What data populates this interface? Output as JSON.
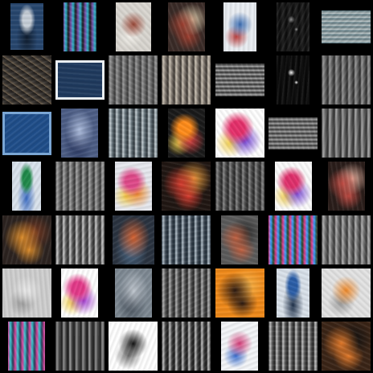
{
  "gallery": {
    "background": "#000000",
    "rows": 7,
    "cols": 7,
    "tiles": [
      {
        "w": 0.62,
        "h": 0.88,
        "bg": "#27466e",
        "a": "#c7cfd8",
        "b": "#0f1d2e",
        "kind": "portrait"
      },
      {
        "w": 0.62,
        "h": 0.92,
        "bg": "#1a1a1f",
        "a": "#7a4fa8",
        "b": "#2fb3c9",
        "kind": "noisy"
      },
      {
        "w": 0.66,
        "h": 0.92,
        "bg": "#d9d6d0",
        "a": "#9c4a3a",
        "b": "#f1efe9",
        "kind": "light"
      },
      {
        "w": 0.7,
        "h": 0.92,
        "bg": "#3a2b27",
        "a": "#9c3e2f",
        "b": "#d9c9a9",
        "kind": "blob"
      },
      {
        "w": 0.62,
        "h": 0.92,
        "bg": "#e9edf2",
        "a": "#3b6db3",
        "b": "#b83c3c",
        "kind": "light"
      },
      {
        "w": 0.62,
        "h": 0.92,
        "bg": "#0a0a0a",
        "a": "#8a8a8a",
        "b": "#222",
        "kind": "dark"
      },
      {
        "w": 0.92,
        "h": 0.62,
        "bg": "#7a8a8e",
        "a": "#b8c4c6",
        "b": "#3c5d68",
        "kind": "wide"
      },
      {
        "w": 0.92,
        "h": 0.92,
        "bg": "#3a3632",
        "a": "#6e5f4c",
        "b": "#1e1b19",
        "kind": "texture"
      },
      {
        "w": 0.92,
        "h": 0.74,
        "bg": "#1f3a5e",
        "a": "#e9eef2",
        "b": "#2d6aa0",
        "kind": "framed"
      },
      {
        "w": 0.92,
        "h": 0.92,
        "bg": "#6a6a6a",
        "a": "#9b9b9b",
        "b": "#3a3a3a",
        "kind": "gray"
      },
      {
        "w": 0.92,
        "h": 0.92,
        "bg": "#7a726a",
        "a": "#cfc6b8",
        "b": "#3a3530",
        "kind": "gray"
      },
      {
        "w": 0.92,
        "h": 0.62,
        "bg": "#3a3a3a",
        "a": "#a9a9a9",
        "b": "#1a1a1a",
        "kind": "wide"
      },
      {
        "w": 0.62,
        "h": 0.92,
        "bg": "#050505",
        "a": "#ffffff",
        "b": "#111",
        "kind": "dark"
      },
      {
        "w": 0.92,
        "h": 0.92,
        "bg": "#5f5f5f",
        "a": "#999",
        "b": "#2b2b2b",
        "kind": "gray"
      },
      {
        "w": 0.92,
        "h": 0.82,
        "bg": "#1f4e8a",
        "a": "#7aa6d4",
        "b": "#0e2a4f",
        "kind": "framed"
      },
      {
        "w": 0.7,
        "h": 0.92,
        "bg": "#4d5e86",
        "a": "#b0c0e0",
        "b": "#23305a",
        "kind": "blur"
      },
      {
        "w": 0.92,
        "h": 0.92,
        "bg": "#5e6b72",
        "a": "#c7d1d6",
        "b": "#2f383e",
        "kind": "gray"
      },
      {
        "w": 0.7,
        "h": 0.92,
        "bg": "#1a1a1a",
        "a": "#ff8c1a",
        "b": "#d84040",
        "kind": "colorblob"
      },
      {
        "w": 0.92,
        "h": 0.92,
        "bg": "#ffffff",
        "a": "#e6306b",
        "b": "#6c3bd1",
        "kind": "colorblob"
      },
      {
        "w": 0.92,
        "h": 0.6,
        "bg": "#3c3c3c",
        "a": "#a5a5a5",
        "b": "#2a2a2a",
        "kind": "wide"
      },
      {
        "w": 0.92,
        "h": 0.92,
        "bg": "#5e5e5e",
        "a": "#a9a9a9",
        "b": "#2e2e2e",
        "kind": "gray"
      },
      {
        "w": 0.54,
        "h": 0.92,
        "bg": "#d9e2ec",
        "a": "#1f8a4a",
        "b": "#3b6cc3",
        "kind": "portrait"
      },
      {
        "w": 0.92,
        "h": 0.92,
        "bg": "#6b6b6b",
        "a": "#a8a8a8",
        "b": "#333",
        "kind": "gray"
      },
      {
        "w": 0.7,
        "h": 0.92,
        "bg": "#e6e8ee",
        "a": "#e04a8a",
        "b": "#f08a2a",
        "kind": "colorblob"
      },
      {
        "w": 0.92,
        "h": 0.92,
        "bg": "#201612",
        "a": "#d53b2e",
        "b": "#f0a03c",
        "kind": "blob"
      },
      {
        "w": 0.92,
        "h": 0.92,
        "bg": "#4a4a4a",
        "a": "#8b8b8b",
        "b": "#262626",
        "kind": "gray"
      },
      {
        "w": 0.7,
        "h": 0.92,
        "bg": "#fbfbfb",
        "a": "#e0306c",
        "b": "#7b4bd8",
        "kind": "colorblob"
      },
      {
        "w": 0.7,
        "h": 0.92,
        "bg": "#2a1d1a",
        "a": "#c04b43",
        "b": "#e4b2a0",
        "kind": "blob"
      },
      {
        "w": 0.92,
        "h": 0.92,
        "bg": "#2c2320",
        "a": "#d98a2a",
        "b": "#7a3b22",
        "kind": "blob"
      },
      {
        "w": 0.92,
        "h": 0.92,
        "bg": "#5a5a5a",
        "a": "#cfcfcf",
        "b": "#2c2c2c",
        "kind": "gray"
      },
      {
        "w": 0.78,
        "h": 0.92,
        "bg": "#2a3340",
        "a": "#d3602f",
        "b": "#4f6f8f",
        "kind": "blur"
      },
      {
        "w": 0.92,
        "h": 0.92,
        "bg": "#3a4550",
        "a": "#b5c2cc",
        "b": "#1f2b36",
        "kind": "gray"
      },
      {
        "w": 0.7,
        "h": 0.92,
        "bg": "#5b5b5b",
        "a": "#c06040",
        "b": "#2a2a2a",
        "kind": "blob"
      },
      {
        "w": 0.92,
        "h": 0.92,
        "bg": "#234a2a",
        "a": "#e63d8c",
        "b": "#3aa0ff",
        "kind": "noisy"
      },
      {
        "w": 0.92,
        "h": 0.92,
        "bg": "#6a6a6a",
        "a": "#b3b3b3",
        "b": "#343434",
        "kind": "gray"
      },
      {
        "w": 0.92,
        "h": 0.92,
        "bg": "#cfcfcf",
        "a": "#e9e9e9",
        "b": "#9c9c9c",
        "kind": "light"
      },
      {
        "w": 0.7,
        "h": 0.92,
        "bg": "#ffffff",
        "a": "#e43a8a",
        "b": "#a23bd0",
        "kind": "colorblob"
      },
      {
        "w": 0.7,
        "h": 0.92,
        "bg": "#7e8993",
        "a": "#c0c7cf",
        "b": "#404a55",
        "kind": "blur"
      },
      {
        "w": 0.92,
        "h": 0.92,
        "bg": "#4f4f4f",
        "a": "#b3b3b3",
        "b": "#262626",
        "kind": "gray"
      },
      {
        "w": 0.92,
        "h": 0.92,
        "bg": "#f08a1a",
        "a": "#2b1a12",
        "b": "#f6b44a",
        "kind": "blob"
      },
      {
        "w": 0.62,
        "h": 0.92,
        "bg": "#d9e1ea",
        "a": "#2b5ea8",
        "b": "#20324c",
        "kind": "portrait"
      },
      {
        "w": 0.92,
        "h": 0.92,
        "bg": "#e3e3e3",
        "a": "#f08a2a",
        "b": "#9a9a9a",
        "kind": "light"
      },
      {
        "w": 0.7,
        "h": 0.92,
        "bg": "#2a3e5a",
        "a": "#e0409a",
        "b": "#39c6d1",
        "kind": "noisy"
      },
      {
        "w": 0.92,
        "h": 0.92,
        "bg": "#3d3d3d",
        "a": "#9a9a9a",
        "b": "#1a1a1a",
        "kind": "gray"
      },
      {
        "w": 0.92,
        "h": 0.92,
        "bg": "#ffffff",
        "a": "#111111",
        "b": "#777",
        "kind": "light"
      },
      {
        "w": 0.92,
        "h": 0.92,
        "bg": "#3a3a3a",
        "a": "#c5c5c5",
        "b": "#1a1a1a",
        "kind": "gray"
      },
      {
        "w": 0.7,
        "h": 0.92,
        "bg": "#f3f5f8",
        "a": "#d63f7b",
        "b": "#3b6fd0",
        "kind": "light"
      },
      {
        "w": 0.92,
        "h": 0.92,
        "bg": "#515151",
        "a": "#c4c4c4",
        "b": "#232323",
        "kind": "gray"
      },
      {
        "w": 0.92,
        "h": 0.92,
        "bg": "#3a2416",
        "a": "#e37a2a",
        "b": "#0f0f0f",
        "kind": "blob"
      }
    ]
  }
}
